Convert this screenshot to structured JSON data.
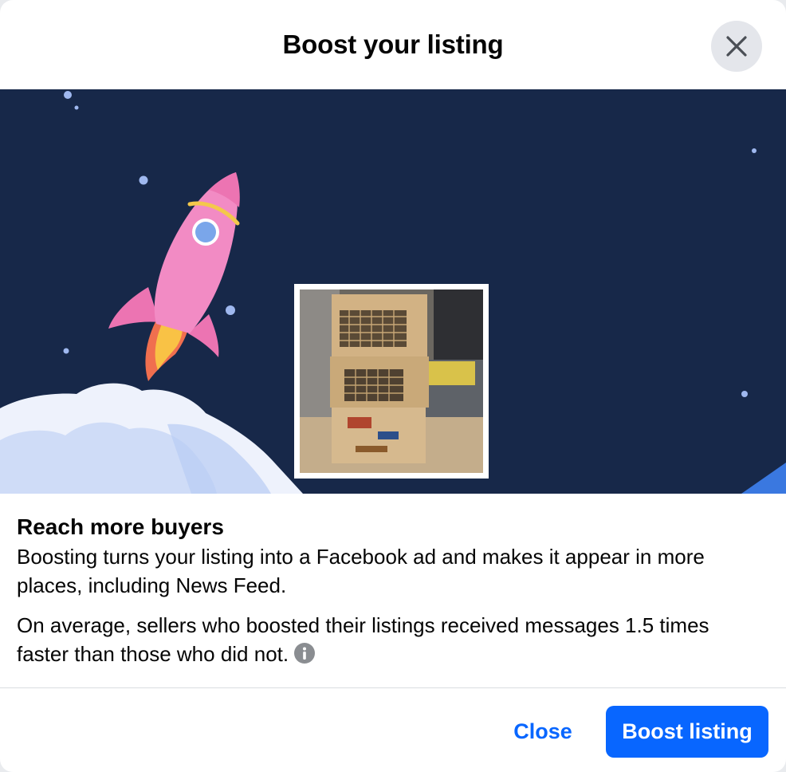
{
  "dialog": {
    "title": "Boost your listing",
    "close_icon": "close-icon"
  },
  "hero": {
    "illustration": "rocket-launch-illustration",
    "listing_photo": "stacked-wooden-crates-photo"
  },
  "content": {
    "heading": "Reach more buyers",
    "paragraph1": "Boosting turns your listing into a Facebook ad and makes it appear in more places, including News Feed.",
    "paragraph2": "On average, sellers who boosted their listings received messages 1.5 times faster than those who did not.",
    "info_icon": "info-icon"
  },
  "footer": {
    "close_label": "Close",
    "boost_label": "Boost listing"
  },
  "colors": {
    "accent": "#0866ff",
    "hero_bg": "#172849",
    "rocket": "#f28bc4"
  }
}
